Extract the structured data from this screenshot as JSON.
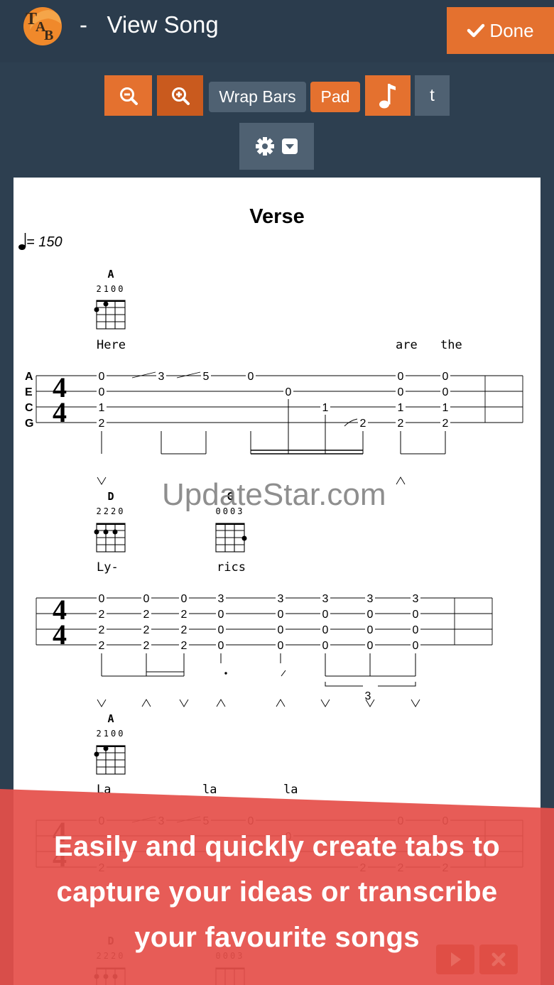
{
  "header": {
    "separator": "-",
    "title": "View Song",
    "done_label": "Done"
  },
  "toolbar": {
    "zoom_out": "zoom-out-icon",
    "zoom_in": "zoom-in-icon",
    "wrap_bars_label": "Wrap Bars",
    "pad_label": "Pad",
    "note_icon": "music-note-icon",
    "t_label": "t",
    "settings_icon": "gear-icon",
    "dropdown_icon": "dropdown-square-icon"
  },
  "sheet": {
    "section_title": "Verse",
    "tempo": "= 150",
    "strings": [
      "A",
      "E",
      "C",
      "G"
    ],
    "time_signature": [
      "4",
      "4"
    ],
    "line1": {
      "chord": {
        "name": "A",
        "fingering": "2100"
      },
      "lyrics": [
        "Here",
        "are",
        "the"
      ],
      "frets": [
        "0",
        "3",
        "5",
        "0",
        "0",
        "0",
        "0",
        "0",
        "1",
        "1",
        "1",
        "2",
        "2",
        "2",
        "2"
      ]
    },
    "line2": {
      "chords": [
        {
          "name": "D",
          "fingering": "2220"
        },
        {
          "name": "G",
          "fingering": "0003"
        }
      ],
      "lyrics": [
        "Ly-",
        "rics"
      ],
      "top_frets": [
        "0",
        "0",
        "0",
        "3",
        "3",
        "3",
        "3",
        "3"
      ],
      "mid_frets": [
        "2",
        "2",
        "2",
        "0",
        "0",
        "0",
        "0",
        "0"
      ],
      "tuplet": "3"
    },
    "line3": {
      "chord": {
        "name": "A",
        "fingering": "2100"
      },
      "lyrics": [
        "La",
        "la",
        "la"
      ],
      "frets": [
        "0",
        "3",
        "5",
        "0",
        "0",
        "0",
        "0",
        "2",
        "2",
        "2",
        "2"
      ]
    },
    "line4": {
      "chords": [
        {
          "name": "D",
          "fingering": "2220"
        },
        {
          "name": "G",
          "fingering": "0003"
        }
      ]
    }
  },
  "watermark": "UpdateStar.com",
  "promo": {
    "line1": "Easily and quickly create tabs to",
    "line2": "capture your ideas or transcribe",
    "line3": "your favourite songs"
  },
  "playback": {
    "play_icon": "play-icon",
    "close_icon": "close-icon"
  },
  "colors": {
    "accent": "#e4712f",
    "header_bg": "#2b3c4d",
    "promo_bg": "#e5504a",
    "grey_button": "#4f6172"
  }
}
